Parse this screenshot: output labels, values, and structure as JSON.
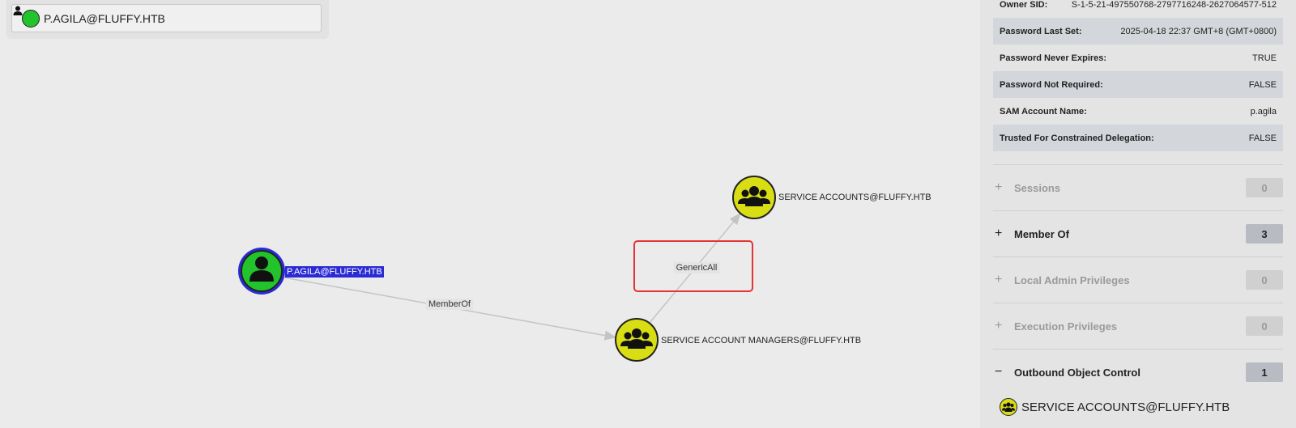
{
  "search": {
    "value": "P.AGILA@FLUFFY.HTB",
    "icon": "user-icon"
  },
  "graph": {
    "nodes": [
      {
        "id": "user",
        "label": "P.AGILA@FLUFFY.HTB",
        "type": "user",
        "selected": true,
        "color": "#22c32c"
      },
      {
        "id": "sam",
        "label": "SERVICE ACCOUNT MANAGERS@FLUFFY.HTB",
        "type": "group",
        "color": "#d9dd14"
      },
      {
        "id": "sa",
        "label": "SERVICE ACCOUNTS@FLUFFY.HTB",
        "type": "group",
        "color": "#d9dd14"
      }
    ],
    "edges": [
      {
        "label": "MemberOf"
      },
      {
        "label": "GenericAll"
      }
    ],
    "highlight_color": "#e53232",
    "selection_color": "#2b2bd6"
  },
  "properties": [
    {
      "key": "Owner SID:",
      "value": "S-1-5-21-497550768-2797716248-2627064577-512"
    },
    {
      "key": "Password Last Set:",
      "value": "2025-04-18 22:37 GMT+8 (GMT+0800)"
    },
    {
      "key": "Password Never Expires:",
      "value": "TRUE"
    },
    {
      "key": "Password Not Required:",
      "value": "FALSE"
    },
    {
      "key": "SAM Account Name:",
      "value": "p.agila"
    },
    {
      "key": "Trusted For Constrained Delegation:",
      "value": "FALSE"
    }
  ],
  "sections": [
    {
      "toggle": "+",
      "title": "Sessions",
      "count": "0"
    },
    {
      "toggle": "+",
      "title": "Member Of",
      "count": "3"
    },
    {
      "toggle": "+",
      "title": "Local Admin Privileges",
      "count": "0"
    },
    {
      "toggle": "+",
      "title": "Execution Privileges",
      "count": "0"
    },
    {
      "toggle": "−",
      "title": "Outbound Object Control",
      "count": "1"
    }
  ],
  "outbound_item": {
    "label": "SERVICE ACCOUNTS@FLUFFY.HTB",
    "icon": "group-icon"
  }
}
